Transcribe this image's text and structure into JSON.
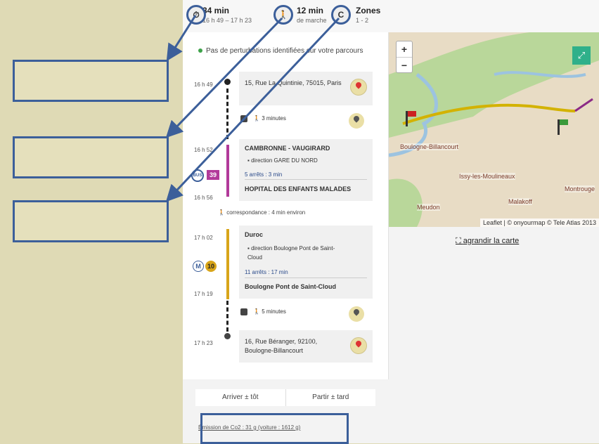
{
  "summary": {
    "duration_value": "34 min",
    "duration_times": "16 h 49 – 17 h 23",
    "walk_value": "12 min",
    "walk_label": "de marche",
    "zones_label": "Zones",
    "zones_value": "1 - 2"
  },
  "disruption_text": "Pas de perturbations identifiées sur votre parcours",
  "timeline": {
    "t1": "16 h 49",
    "t2": "16 h 52",
    "t3": "16 h 56",
    "t4": "17 h 02",
    "t5": "17 h 19",
    "t6": "17 h 23"
  },
  "origin_address": "15, Rue La Quintinie, 75015, Paris",
  "walk1": "3 minutes",
  "bus": {
    "line": "39",
    "from": "CAMBRONNE - VAUGIRARD",
    "direction": "direction GARE DU NORD",
    "stops": "5 arrêts : 3 min",
    "to": "HOPITAL DES ENFANTS MALADES"
  },
  "transfer": "correspondance : 4 min environ",
  "metro": {
    "line": "10",
    "from": "Duroc",
    "direction": "direction Boulogne Pont de Saint-Cloud",
    "stops": "11 arrêts : 17 min",
    "to": "Boulogne Pont de Saint-Cloud"
  },
  "walk2": "5 minutes",
  "destination_address": "16, Rue Béranger, 92100, Boulogne-Billancourt",
  "buttons": {
    "arrive": "Arriver ± tôt",
    "leave": "Partir ± tard"
  },
  "map": {
    "zoom_in": "+",
    "zoom_out": "−",
    "labels": [
      "Boulogne-Billancourt",
      "Issy-les-Moulineaux",
      "Montrouge",
      "Meudon",
      "Malakoff"
    ],
    "attribution": "Leaflet | © onyourmap © Tele Atlas 2013",
    "enlarge": "agrandir la carte"
  },
  "co2": "Émission de Co2 : 31 g (voiture : 1612 g)",
  "colors": {
    "bus": "#b23a9a",
    "metro": "#d8a51a",
    "callout": "#3c5f9a"
  }
}
